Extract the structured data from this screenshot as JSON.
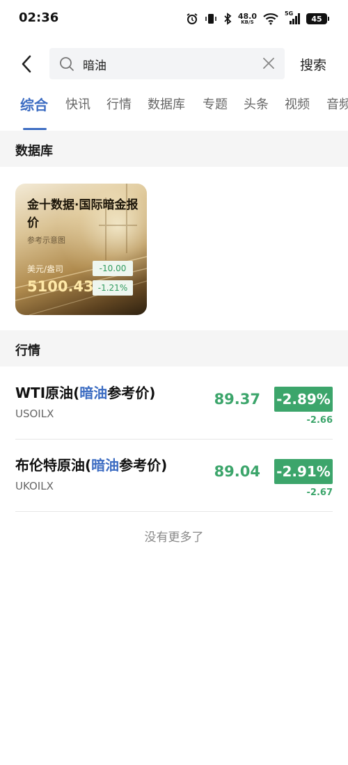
{
  "status_bar": {
    "time": "02:36",
    "net_speed_value": "48.0",
    "net_speed_unit": "KB/S",
    "signal_label": "5G",
    "battery": "45"
  },
  "search": {
    "query": "暗油",
    "button_label": "搜索"
  },
  "tabs": [
    {
      "label": "综合",
      "active": true
    },
    {
      "label": "快讯"
    },
    {
      "label": "行情"
    },
    {
      "label": "数据库"
    },
    {
      "label": "专题"
    },
    {
      "label": "头条"
    },
    {
      "label": "视频"
    },
    {
      "label": "音频"
    }
  ],
  "database_section": {
    "title": "数据库",
    "card": {
      "title": "金十数据·国际暗金报价",
      "subtitle": "参考示意图",
      "unit": "美元/盎司",
      "value": "5100.43",
      "change": "-10.00",
      "change_pct": "-1.21%"
    }
  },
  "market_section": {
    "title": "行情",
    "quotes": [
      {
        "name_prefix": "WTI原油(",
        "name_highlight": "暗油",
        "name_suffix": "参考价)",
        "code": "USOILX",
        "price": "89.37",
        "change_pct": "-2.89%",
        "change": "-2.66"
      },
      {
        "name_prefix": "布伦特原油(",
        "name_highlight": "暗油",
        "name_suffix": "参考价)",
        "code": "UKOILX",
        "price": "89.04",
        "change_pct": "-2.91%",
        "change": "-2.67"
      }
    ]
  },
  "footer": {
    "no_more": "没有更多了"
  },
  "colors": {
    "accent": "#3c6cc2",
    "down_green": "#3ca56b",
    "section_bg": "#f5f5f5"
  }
}
